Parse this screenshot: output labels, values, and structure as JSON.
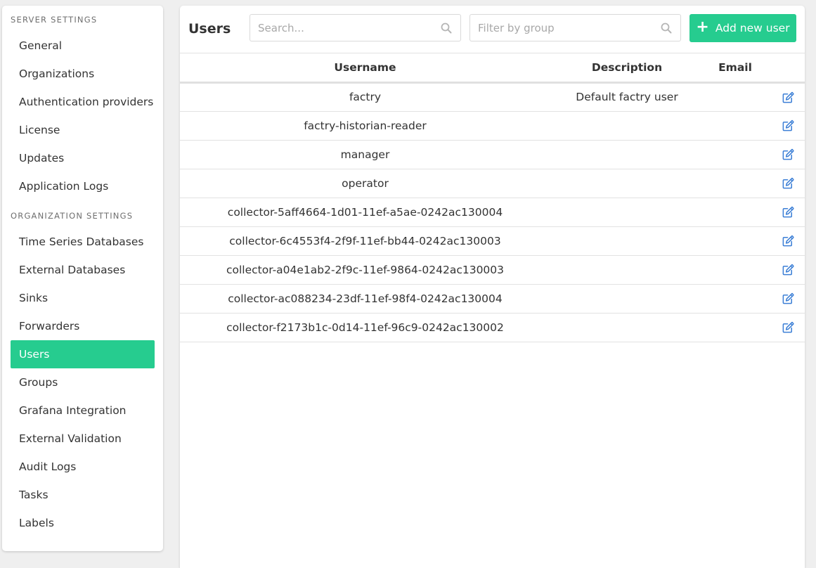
{
  "sidebar": {
    "server_header": "SERVER SETTINGS",
    "server_items": [
      {
        "label": "General"
      },
      {
        "label": "Organizations"
      },
      {
        "label": "Authentication providers"
      },
      {
        "label": "License"
      },
      {
        "label": "Updates"
      },
      {
        "label": "Application Logs"
      }
    ],
    "org_header": "ORGANIZATION SETTINGS",
    "org_items": [
      {
        "label": "Time Series Databases"
      },
      {
        "label": "External Databases"
      },
      {
        "label": "Sinks"
      },
      {
        "label": "Forwarders"
      },
      {
        "label": "Users",
        "active": true
      },
      {
        "label": "Groups"
      },
      {
        "label": "Grafana Integration"
      },
      {
        "label": "External Validation"
      },
      {
        "label": "Audit Logs"
      },
      {
        "label": "Tasks"
      },
      {
        "label": "Labels"
      }
    ]
  },
  "header": {
    "title": "Users",
    "search_placeholder": "Search...",
    "filter_placeholder": "Filter by group",
    "add_button_label": "Add new user",
    "search_icon": "search-icon",
    "add_icon": "plus-icon"
  },
  "table": {
    "columns": [
      "Username",
      "Description",
      "Email"
    ],
    "edit_icon": "edit-icon",
    "rows": [
      {
        "username": "factry",
        "description": "Default factry user",
        "email": ""
      },
      {
        "username": "factry-historian-reader",
        "description": "",
        "email": ""
      },
      {
        "username": "manager",
        "description": "",
        "email": ""
      },
      {
        "username": "operator",
        "description": "",
        "email": ""
      },
      {
        "username": "collector-5aff4664-1d01-11ef-a5ae-0242ac130004",
        "description": "",
        "email": ""
      },
      {
        "username": "collector-6c4553f4-2f9f-11ef-bb44-0242ac130003",
        "description": "",
        "email": ""
      },
      {
        "username": "collector-a04e1ab2-2f9c-11ef-9864-0242ac130003",
        "description": "",
        "email": ""
      },
      {
        "username": "collector-ac088234-23df-11ef-98f4-0242ac130004",
        "description": "",
        "email": ""
      },
      {
        "username": "collector-f2173b1c-0d14-11ef-96c9-0242ac130002",
        "description": "",
        "email": ""
      }
    ]
  },
  "colors": {
    "accent": "#26cc8f",
    "edit_icon": "#3c7fd6"
  }
}
